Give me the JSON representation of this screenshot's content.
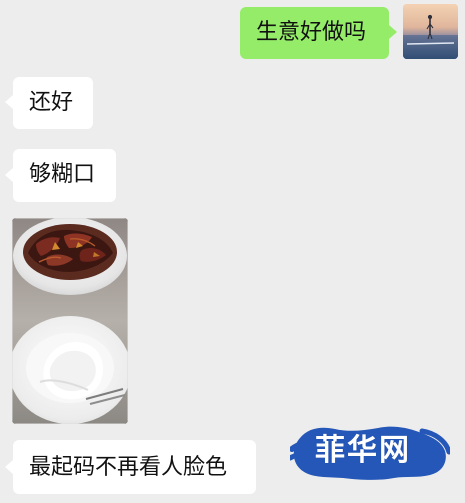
{
  "messages": [
    {
      "direction": "outgoing",
      "text": "生意好做吗"
    },
    {
      "direction": "incoming",
      "text": "还好"
    },
    {
      "direction": "incoming",
      "text": "够糊口"
    },
    {
      "direction": "incoming",
      "type": "image"
    },
    {
      "direction": "incoming",
      "text": "最起码不再看人脸色"
    }
  ],
  "watermark": {
    "text": "菲华网"
  },
  "colors": {
    "background": "#ededed",
    "outgoing_bubble": "#95ec69",
    "incoming_bubble": "#ffffff",
    "watermark_blue": "#2457b8"
  },
  "icons": {
    "avatar": "avatar-icon",
    "image": "food-photo",
    "watermark": "watermark-logo"
  }
}
